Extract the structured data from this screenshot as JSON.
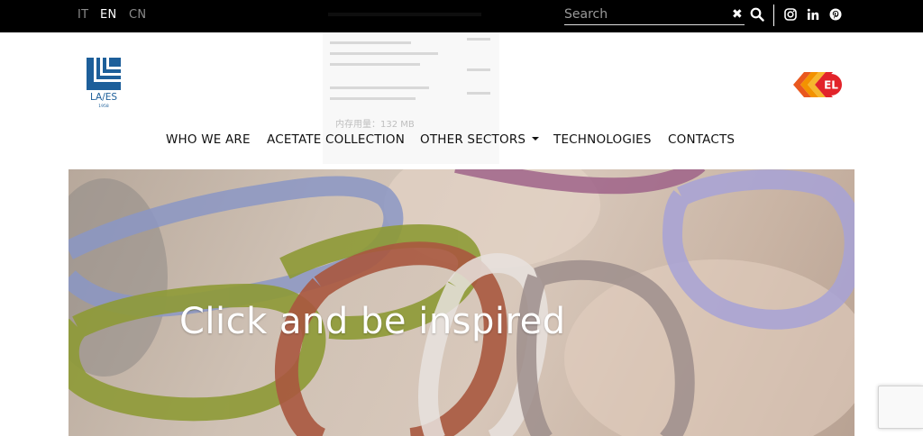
{
  "languages": [
    {
      "code": "IT",
      "active": false
    },
    {
      "code": "EN",
      "active": true
    },
    {
      "code": "CN",
      "active": false
    }
  ],
  "search": {
    "placeholder": "Search",
    "value": ""
  },
  "social": [
    "instagram-icon",
    "linkedin-icon",
    "pinterest-icon"
  ],
  "logo": {
    "brand_text": "LA/ES",
    "year": "1958"
  },
  "nav": {
    "items": [
      "WHO WE ARE",
      "ACETATE COLLECTION",
      "OTHER SECTORS",
      "TECHNOLOGIES",
      "CONTACTS"
    ]
  },
  "hero": {
    "title": "Click and be inspired"
  },
  "overlay": {
    "memory_text": "内存用量：132 MB"
  },
  "colors": {
    "topbar": "#000000",
    "laes_blue": "#1d5f9a",
    "el_red": "#e2232a",
    "el_orange": "#f39200"
  }
}
